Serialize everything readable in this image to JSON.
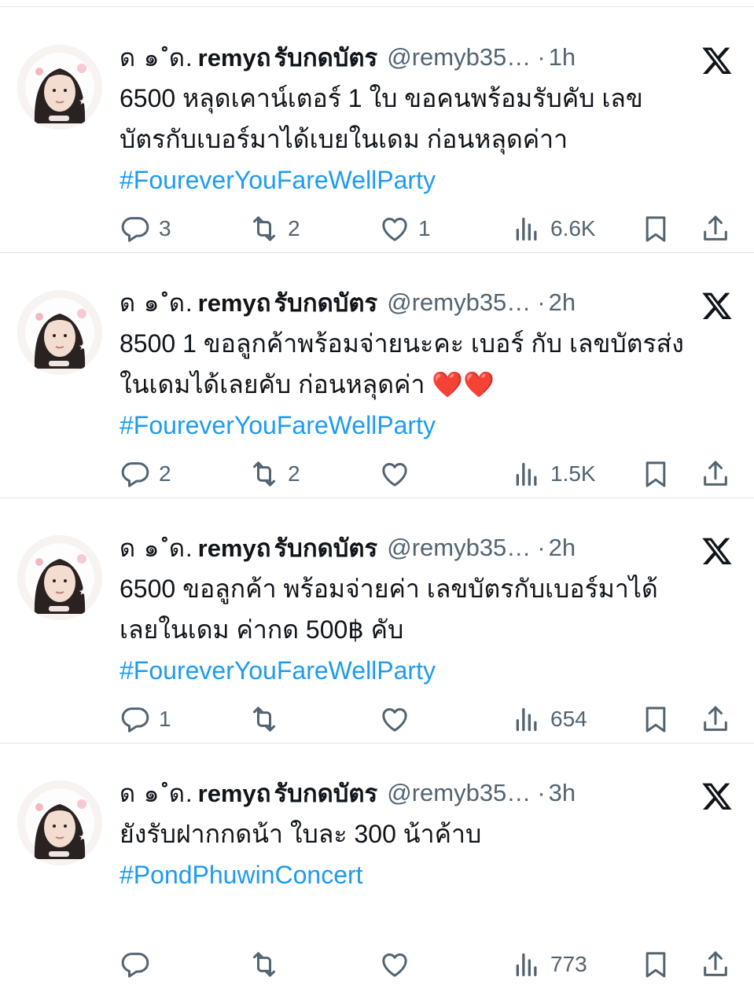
{
  "user": {
    "name_prefix": "ด ๑ ํด.",
    "name_bold": "remyถ",
    "name_suffix": "รับกดบัตร",
    "handle": "@remyb35…"
  },
  "tweets": [
    {
      "time": "1h",
      "lines": [
        "6500 หลุดเคาน์เตอร์ 1 ใบ ขอคนพร้อมรับคับ เลข",
        "บัตรกับเบอร์มาได้เบยในเดม ก่อนหลุดค่าา"
      ],
      "hashtag": "#FoureverYouFareWellParty",
      "replies": "3",
      "reposts": "2",
      "likes": "1",
      "views": "6.6K"
    },
    {
      "time": "2h",
      "lines": [
        "8500 1 ขอลูกค้าพร้อมจ่ายนะคะ เบอร์ กับ เลขบัตรส่ง",
        "ในเดมได้เลยคับ ก่อนหลุดค่า ❤️❤️"
      ],
      "hashtag": "#FoureverYouFareWellParty",
      "replies": "2",
      "reposts": "2",
      "likes": "",
      "views": "1.5K"
    },
    {
      "time": "2h",
      "lines": [
        "6500 ขอลูกค้า พร้อมจ่ายค่า เลขบัตรกับเบอร์มาได้",
        "เลยในเดม ค่ากด 500฿ คับ"
      ],
      "hashtag": "#FoureverYouFareWellParty",
      "replies": "1",
      "reposts": "",
      "likes": "",
      "views": "654"
    },
    {
      "time": "3h",
      "lines": [
        "ยังรับฝากกดน้า ใบละ 300 น้าค้าบ"
      ],
      "hashtag": "#PondPhuwinConcert",
      "replies": "",
      "reposts": "",
      "likes": "",
      "views": "773"
    }
  ],
  "ui": {
    "separator": "·"
  },
  "icons": [
    "reply-icon",
    "repost-icon",
    "like-icon",
    "views-icon",
    "bookmark-icon",
    "share-icon",
    "x-logo-icon"
  ],
  "colors": {
    "text": "#0f1419",
    "secondary": "#536471",
    "hashtag": "#1d9bf0",
    "divider": "#e6e8ea"
  }
}
